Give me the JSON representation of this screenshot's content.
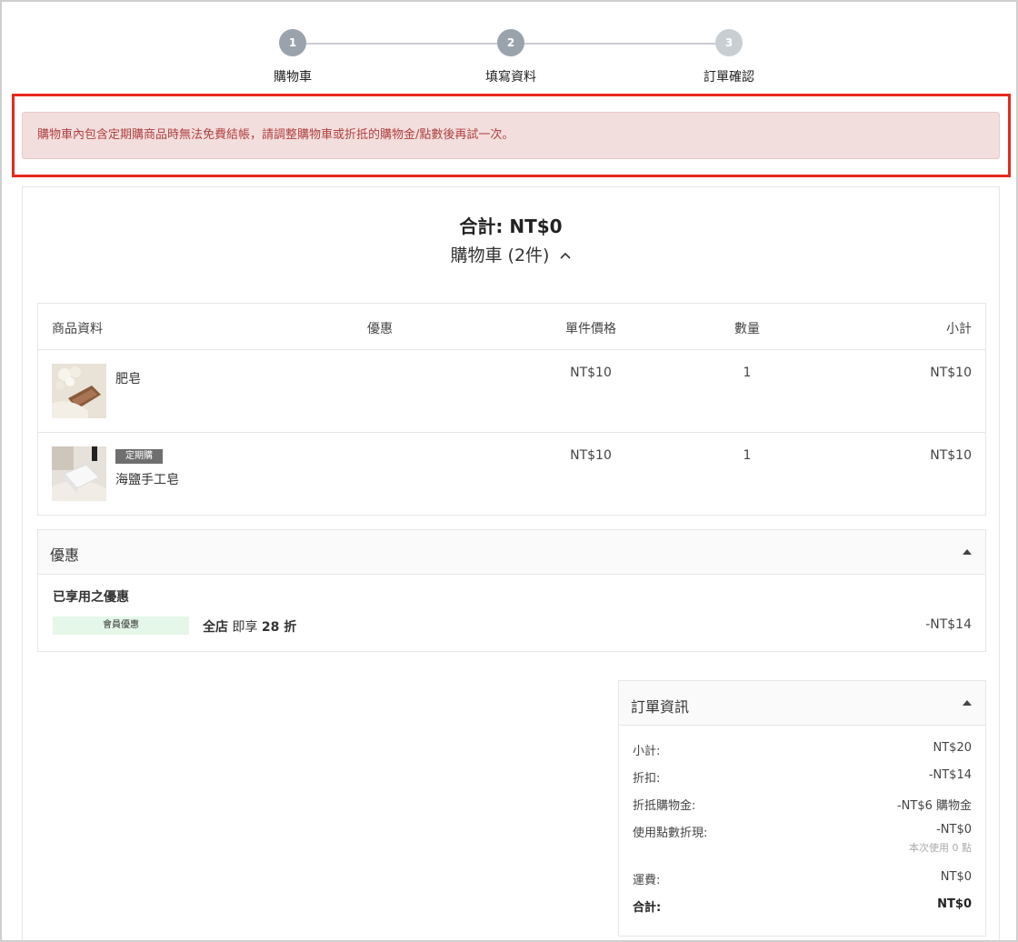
{
  "stepper": {
    "steps": [
      {
        "number": "1",
        "label": "購物車",
        "state": "done"
      },
      {
        "number": "2",
        "label": "填寫資料",
        "state": "done"
      },
      {
        "number": "3",
        "label": "訂單確認",
        "state": "todo"
      }
    ]
  },
  "alert": {
    "message": "購物車內包含定期購商品時無法免費結帳，請調整購物車或折抵的購物金/點數後再試一次。"
  },
  "summary": {
    "total": "合計: NT$0",
    "cart_label": "購物車 (2件)"
  },
  "items_table": {
    "headers": {
      "name": "商品資料",
      "discount": "優惠",
      "unit_price": "單件價格",
      "quantity": "數量",
      "subtotal": "小計"
    },
    "rows": [
      {
        "name": "肥皂",
        "tag": "",
        "unit_price": "NT$10",
        "quantity": "1",
        "subtotal": "NT$10"
      },
      {
        "name": "海鹽手工皂",
        "tag": "定期購",
        "unit_price": "NT$10",
        "quantity": "1",
        "subtotal": "NT$10"
      }
    ]
  },
  "promotions": {
    "title": "優惠",
    "applied_title": "已享用之優惠",
    "badge": "會員優惠",
    "desc_prefix": "全店",
    "desc_mid": " 即享 ",
    "desc_value": "28 折",
    "amount": "-NT$14"
  },
  "order_info": {
    "title": "訂單資訊",
    "subtotal_label": "小計:",
    "subtotal_value": "NT$20",
    "discount_label": "折扣:",
    "discount_value": "-NT$14",
    "credit_label": "折抵購物金:",
    "credit_value": "-NT$6 購物金",
    "points_label": "使用點數折現:",
    "points_value": "-NT$0",
    "points_note": "本次使用 0 點",
    "shipping_label": "運費:",
    "shipping_value": "NT$0",
    "total_label": "合計:",
    "total_value": "NT$0"
  },
  "colors": {
    "alert_bg": "#f3dede",
    "alert_text": "#b04040",
    "highlight_outline": "#e8291d",
    "member_badge_bg": "#e5f7e8",
    "tag_bg": "#6f6f6f"
  }
}
